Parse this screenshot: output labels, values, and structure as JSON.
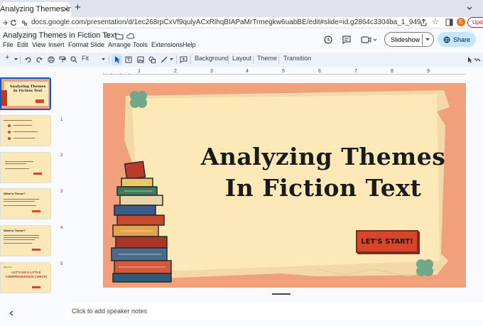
{
  "browser": {
    "tab_title": "Analyzing Themes in Fiction Te",
    "url": "docs.google.com/presentation/d/1ec268rpCxVf9qulyACxRlhqBIAPaMrTrmegkw6uabBE/edit#slide=id.g2864c3304ba_1_949",
    "avatar_letter": "E",
    "update_label": "Upda"
  },
  "doc": {
    "title": "Analyzing Themes in Fiction Text",
    "menus": [
      "File",
      "Edit",
      "View",
      "Insert",
      "Format",
      "Slide",
      "Arrange",
      "Tools",
      "Extensions",
      "Help"
    ],
    "slideshow_label": "Slideshow",
    "share_label": "Share"
  },
  "toolbar": {
    "zoom_label": "Fit",
    "background_label": "Background",
    "layout_label": "Layout",
    "theme_label": "Theme",
    "transition_label": "Transition"
  },
  "ruler": {
    "h_labels": [
      "1",
      "2",
      "3",
      "4",
      "5",
      "6",
      "7",
      "8",
      "9"
    ],
    "v_labels": [
      "1",
      "2",
      "3",
      "4",
      "5"
    ]
  },
  "slide": {
    "title_line1": "Analyzing Themes",
    "title_line2": "In Fiction Text",
    "button_label": "LET'S START!"
  },
  "thumbnails": [
    {
      "title": "Analyzing Themes In Fiction Text",
      "sub": ""
    },
    {
      "title": "",
      "sub": ""
    },
    {
      "title": "",
      "sub": ""
    },
    {
      "title": "What is Theme?",
      "sub": ""
    },
    {
      "title": "What is Theme?",
      "sub": ""
    },
    {
      "title": "LET'S DO A LITTLE COMPREHENSION CHECK!",
      "sub": "Wind up..."
    }
  ],
  "notes_placeholder": "Click to add speaker notes",
  "colors": {
    "slide_bg": "#f0a07a",
    "paper": "#fde9b8",
    "title": "#1a1a1a",
    "button": "#d9452b",
    "clover": "#6fa98a",
    "share_bg": "#c2e7ff",
    "toolbar_bg": "#edf2fa"
  }
}
